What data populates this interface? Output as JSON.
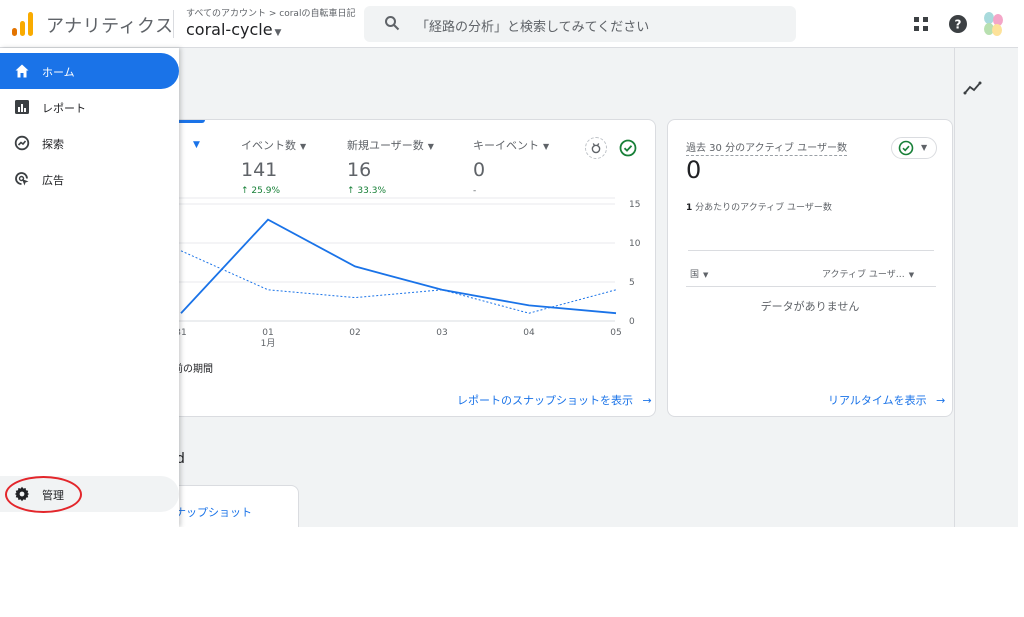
{
  "header": {
    "app_title": "アナリティクス",
    "account_path": "すべてのアカウント > coralの自転車日記",
    "property_name": "coral-cycle",
    "search_placeholder": "「経路の分析」と検索してみてください",
    "icons": [
      "analytics-logo",
      "apps-grid-icon",
      "help-icon",
      "account-avatar"
    ]
  },
  "sidebar": {
    "items": [
      {
        "label": "ホーム",
        "icon": "home-icon",
        "active": true
      },
      {
        "label": "レポート",
        "icon": "reports-icon",
        "active": false
      },
      {
        "label": "探索",
        "icon": "explore-icon",
        "active": false
      },
      {
        "label": "広告",
        "icon": "advertising-icon",
        "active": false
      }
    ],
    "admin_label": "管理"
  },
  "overview_card": {
    "metrics": [
      {
        "label": "イベント数",
        "value": "141",
        "delta": "↑ 25.9%"
      },
      {
        "label": "新規ユーザー数",
        "value": "16",
        "delta": "↑ 33.3%"
      },
      {
        "label": "キーイベント",
        "value": "0",
        "delta": "-"
      }
    ],
    "period_label": "前の期間",
    "link_label": "レポートのスナップショットを表示"
  },
  "chart_data": {
    "type": "line",
    "x": [
      "31",
      "01",
      "02",
      "03",
      "04",
      "05"
    ],
    "x_sublabels": [
      "",
      "1月",
      "",
      "",
      "",
      ""
    ],
    "y_ticks": [
      0,
      5,
      10,
      15
    ],
    "ylim": [
      0,
      15
    ],
    "series": [
      {
        "style": "solid",
        "values": [
          1,
          13,
          7,
          4,
          2,
          1
        ]
      },
      {
        "style": "dashed",
        "values": [
          9,
          4,
          3,
          4,
          1,
          4
        ]
      }
    ],
    "color": "#1a73e8",
    "grid": true
  },
  "realtime_card": {
    "title": "過去 30 分のアクティブ ユーザー数",
    "value": "0",
    "subtitle_bold": "1",
    "subtitle": "分あたりのアクティブ ユーザー数",
    "col_country": "国",
    "col_active": "アクティブ ユーザ…",
    "empty": "データがありません",
    "link_label": "リアルタイムを表示"
  },
  "section": {
    "label": "d",
    "snapshot_link": "ナップショット"
  },
  "colors": {
    "accent": "#1a73e8",
    "positive": "#188038",
    "annotation": "#e3262b"
  }
}
